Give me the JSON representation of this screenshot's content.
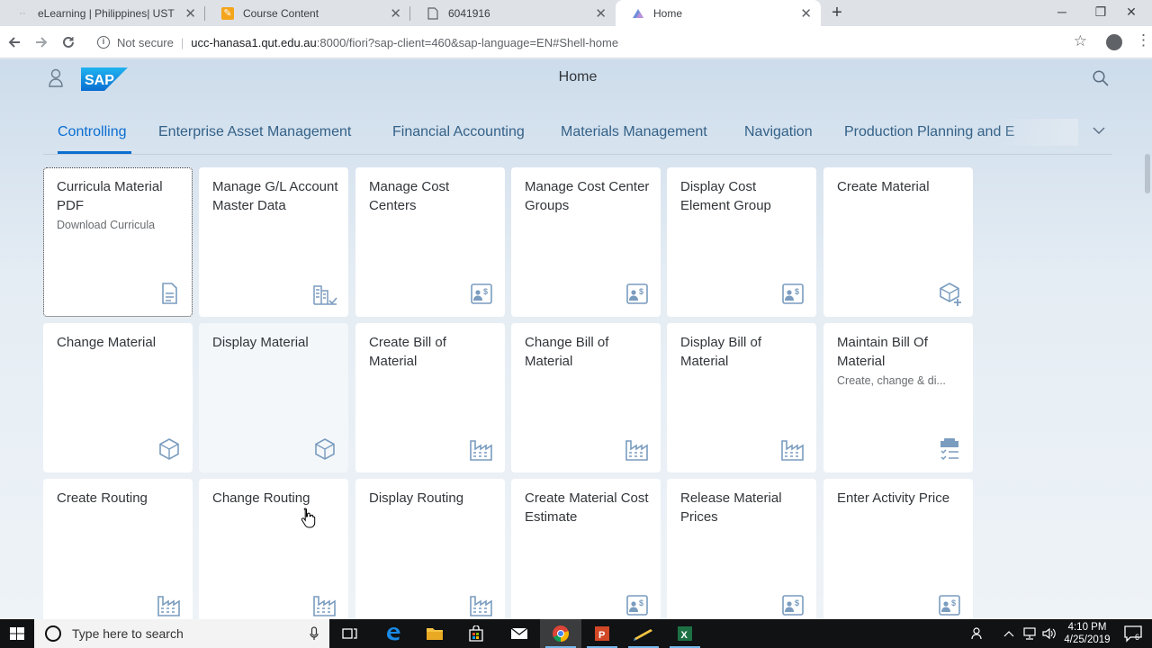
{
  "browser": {
    "tabs": [
      {
        "title": "eLearning | Philippines| UST Educ",
        "active": false
      },
      {
        "title": "Course Content",
        "active": false
      },
      {
        "title": "6041916",
        "active": false
      },
      {
        "title": "Home",
        "active": true
      }
    ],
    "new_tab": "+",
    "window_controls": {
      "minimize": "─",
      "maximize": "❐",
      "close": "✕"
    },
    "address": {
      "security_label": "Not secure",
      "host": "ucc-hanasa1.qut.edu.au",
      "rest": ":8000/fiori?sap-client=460&sap-language=EN#Shell-home"
    }
  },
  "shell": {
    "logo_text": "SAP",
    "title": "Home"
  },
  "groups": [
    {
      "label": "Controlling",
      "selected": true
    },
    {
      "label": "Enterprise Asset Management",
      "selected": false
    },
    {
      "label": "Financial Accounting",
      "selected": false
    },
    {
      "label": "Materials Management",
      "selected": false
    },
    {
      "label": "Navigation",
      "selected": false
    },
    {
      "label": "Production Planning and E",
      "selected": false
    }
  ],
  "tiles": [
    {
      "title": "Curricula Material PDF",
      "subtitle": "Download Curricula",
      "icon": "document-icon",
      "focused": true
    },
    {
      "title": "Manage G/L Account Master Data",
      "subtitle": "",
      "icon": "accounting-icon"
    },
    {
      "title": "Manage Cost Centers",
      "subtitle": "",
      "icon": "cost-center-icon"
    },
    {
      "title": "Manage Cost Center Groups",
      "subtitle": "",
      "icon": "cost-center-icon"
    },
    {
      "title": "Display Cost Element Group",
      "subtitle": "",
      "icon": "cost-center-icon"
    },
    {
      "title": "Create Material",
      "subtitle": "",
      "icon": "add-product-icon"
    },
    {
      "title": "Change Material",
      "subtitle": "",
      "icon": "product-icon"
    },
    {
      "title": "Display Material",
      "subtitle": "",
      "icon": "product-icon",
      "hover": true
    },
    {
      "title": "Create Bill of Material",
      "subtitle": "",
      "icon": "factory-icon"
    },
    {
      "title": "Change Bill of Material",
      "subtitle": "",
      "icon": "factory-icon"
    },
    {
      "title": "Display Bill of Material",
      "subtitle": "",
      "icon": "factory-icon"
    },
    {
      "title": "Maintain Bill Of Material",
      "subtitle": "Create, change & di...",
      "icon": "clipboard-list-icon"
    },
    {
      "title": "Create Routing",
      "subtitle": "",
      "icon": "factory-icon"
    },
    {
      "title": "Change Routing",
      "subtitle": "",
      "icon": "factory-icon"
    },
    {
      "title": "Display Routing",
      "subtitle": "",
      "icon": "factory-icon"
    },
    {
      "title": "Create Material Cost Estimate",
      "subtitle": "",
      "icon": "cost-center-icon"
    },
    {
      "title": "Release Material Prices",
      "subtitle": "",
      "icon": "cost-center-icon"
    },
    {
      "title": "Enter Activity Price",
      "subtitle": "",
      "icon": "cost-center-icon"
    }
  ],
  "taskbar": {
    "search_placeholder": "Type here to search",
    "time": "4:10 PM",
    "date": "4/25/2019",
    "notification_count": "6"
  },
  "colors": {
    "accent": "#0a6ed1",
    "tile_icon": "#7a9cbf",
    "group_text": "#346187"
  }
}
